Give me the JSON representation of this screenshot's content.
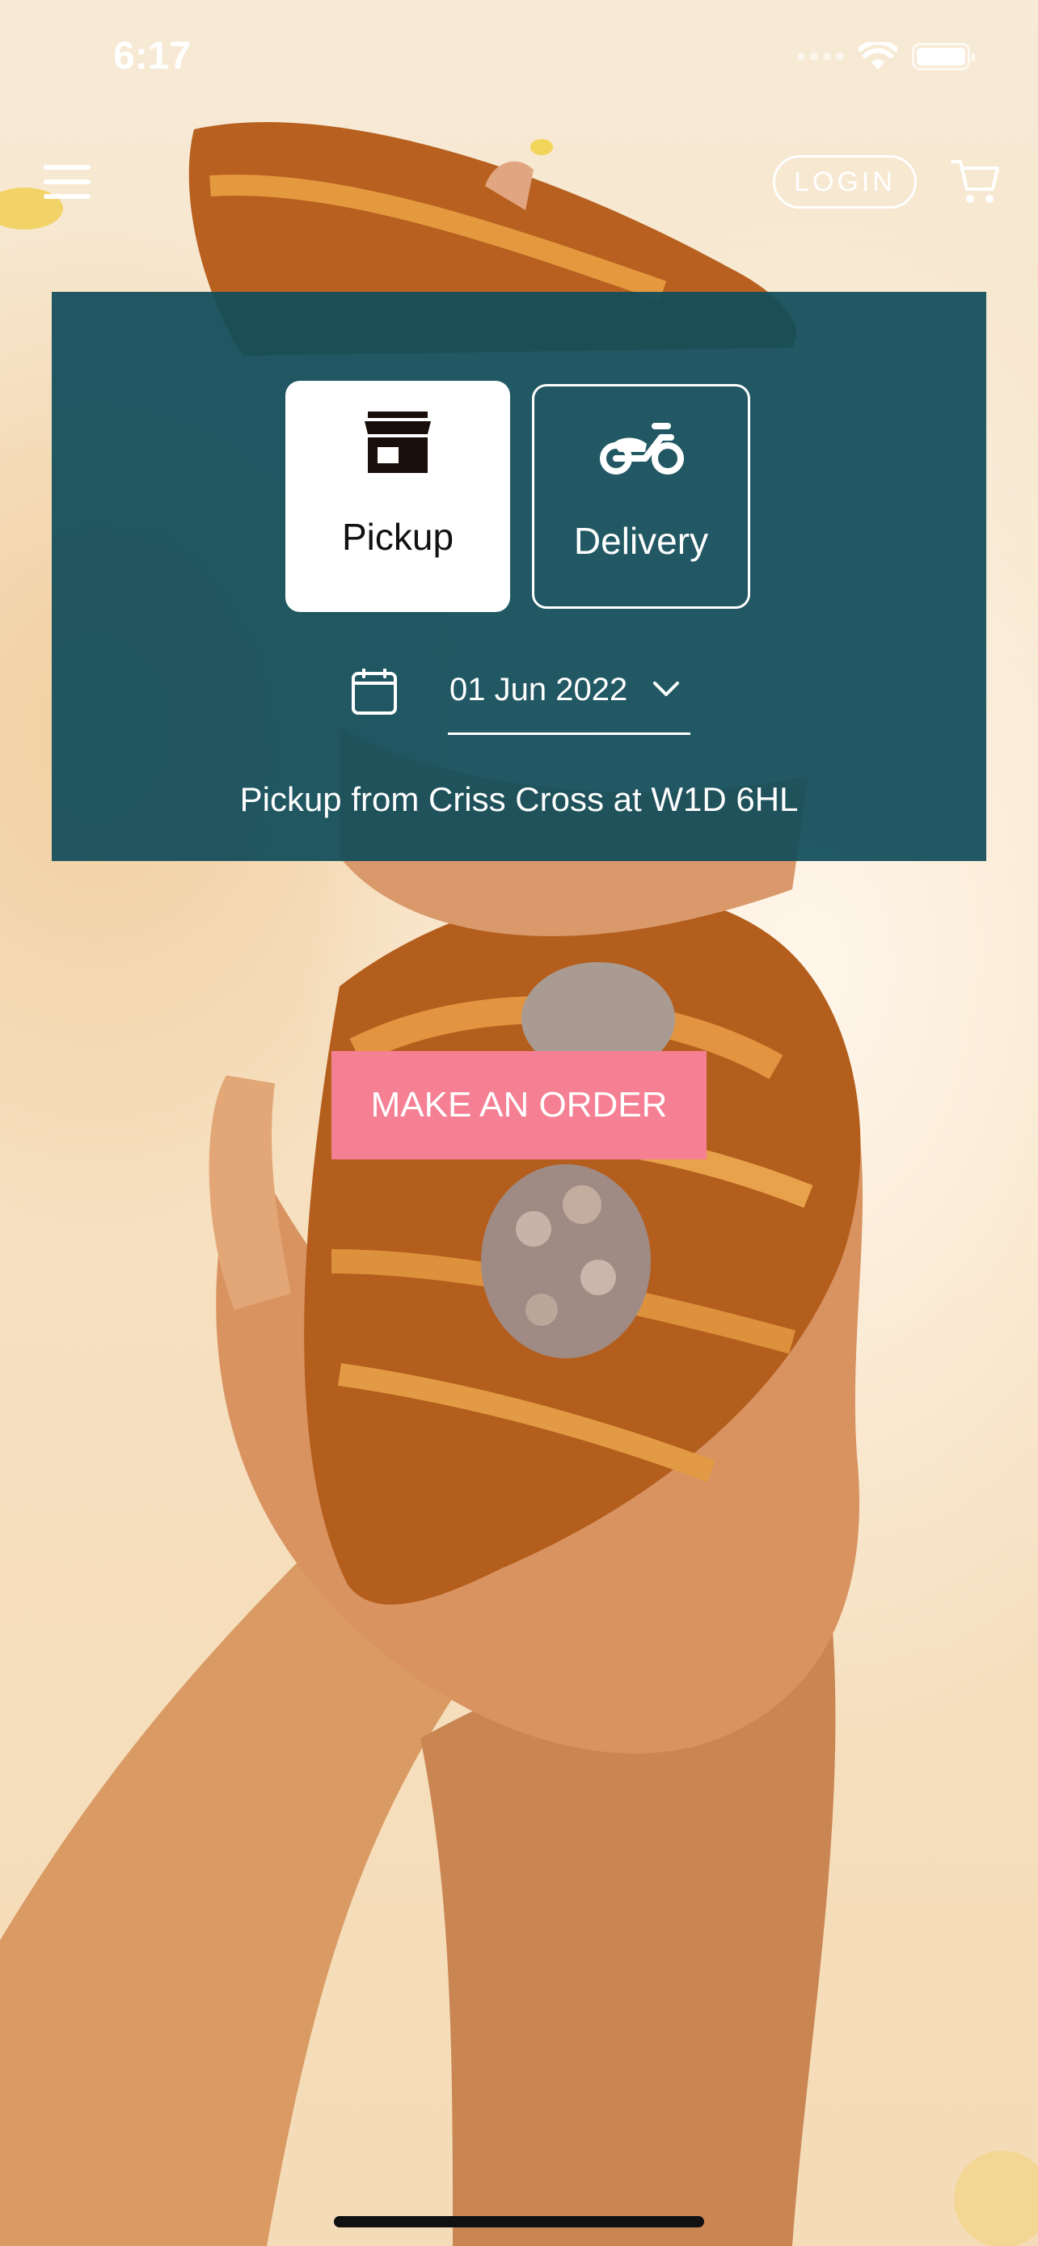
{
  "status_bar": {
    "time": "6:17",
    "battery_level": 1.0
  },
  "header": {
    "menu_icon": "hamburger-menu-icon",
    "login_label": "LOGIN",
    "cart_icon": "shopping-cart-icon"
  },
  "fulfilment": {
    "options": [
      {
        "label": "Pickup",
        "icon": "storefront-icon",
        "selected": true
      },
      {
        "label": "Delivery",
        "icon": "scooter-icon",
        "selected": false
      }
    ],
    "date_icon": "calendar-icon",
    "date_value": "01 Jun 2022",
    "note": "Pickup from Criss Cross at W1D 6HL"
  },
  "cta": {
    "label": "MAKE AN ORDER"
  },
  "colors": {
    "panel": "#104C5A",
    "cta": "#F57F93",
    "text_light": "#FFFFFF"
  }
}
